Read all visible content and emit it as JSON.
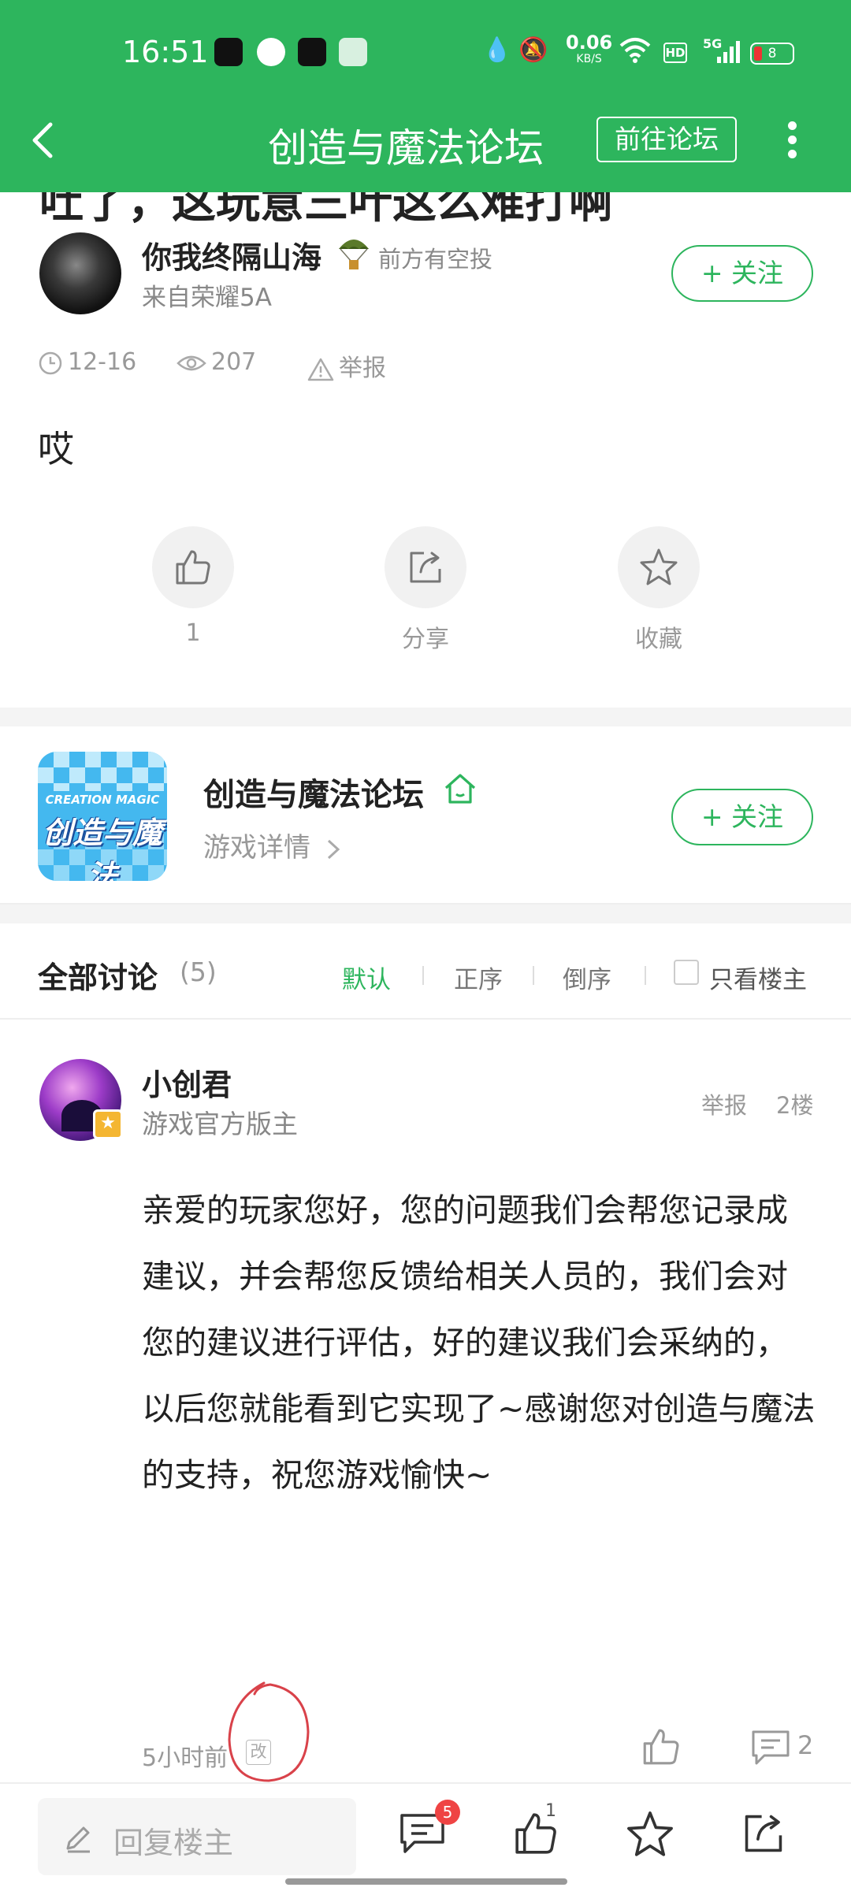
{
  "status_bar": {
    "time": "16:51",
    "net_speed": "0.06",
    "net_unit": "KB/S",
    "hd": "HD",
    "signal": "5G",
    "battery": "8"
  },
  "header": {
    "title": "创造与魔法论坛",
    "forum_button": "前往论坛"
  },
  "post": {
    "title_peek": "吐了，这玩意三叶这么难打啊",
    "author": {
      "name": "你我终隔山海",
      "badge": "前方有空投",
      "device": "来自荣耀5A",
      "follow": "+ 关注"
    },
    "meta": {
      "date": "12-16",
      "views": "207",
      "report": "举报"
    },
    "body": "哎",
    "actions": {
      "like_count": "1",
      "share": "分享",
      "favorite": "收藏"
    }
  },
  "forum_card": {
    "logo_en": "CREATION MAGIC",
    "logo_cn": "创造与魔法",
    "name": "创造与魔法论坛",
    "detail": "游戏详情",
    "follow": "+ 关注"
  },
  "discussion": {
    "title": "全部讨论",
    "count": "(5)",
    "sort": [
      "默认",
      "正序",
      "倒序"
    ],
    "only_host": "只看楼主"
  },
  "comment": {
    "name": "小创君",
    "role": "游戏官方版主",
    "report": "举报",
    "floor": "2楼",
    "body": "亲爱的玩家您好，您的问题我们会帮您记录成建议，并会帮您反馈给相关人员的，我们会对您的建议进行评估，好的建议我们会采纳的，以后您就能看到它实现了~感谢您对创造与魔法的支持，祝您游戏愉快~",
    "time": "5小时前",
    "edited": "改",
    "reply_count": "2"
  },
  "bottom_bar": {
    "reply_placeholder": "回复楼主",
    "comments_badge": "5",
    "likes_count": "1"
  },
  "colors": {
    "brand": "#2db55d",
    "badge": "#ef4444"
  }
}
